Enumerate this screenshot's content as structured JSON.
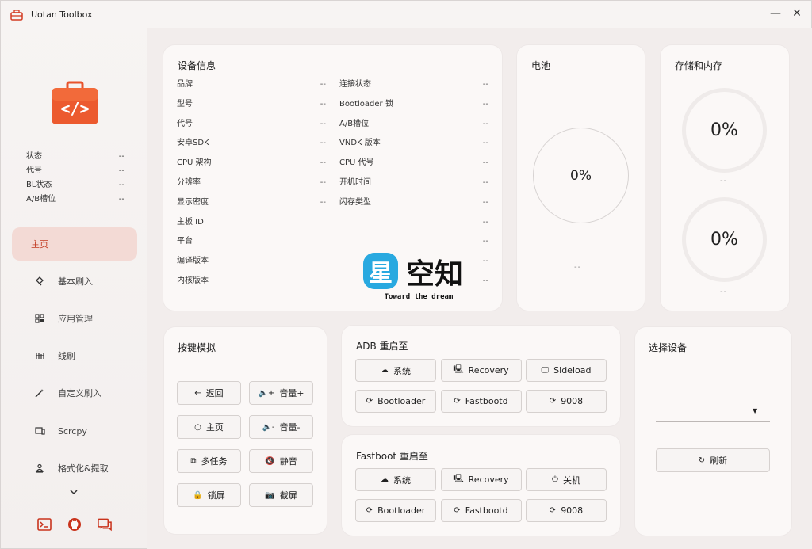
{
  "app": {
    "title": "Uotan Toolbox"
  },
  "window_controls": {
    "minimize": "—",
    "close": "✕"
  },
  "colors": {
    "accent": "#e8532c",
    "accent_bg": "#f3dad5",
    "active_text": "#c23b22"
  },
  "sidebar": {
    "status": [
      {
        "label": "状态",
        "value": "--"
      },
      {
        "label": "代号",
        "value": "--"
      },
      {
        "label": "BL状态",
        "value": "--"
      },
      {
        "label": "A/B槽位",
        "value": "--"
      }
    ],
    "nav": [
      {
        "label": "主页",
        "icon": "home-icon",
        "active": true
      },
      {
        "label": "基本刷入",
        "icon": "flash-icon"
      },
      {
        "label": "应用管理",
        "icon": "apps-grid-icon"
      },
      {
        "label": "线刷",
        "icon": "wire-flash-icon"
      },
      {
        "label": "自定义刷入",
        "icon": "magic-wand-icon"
      },
      {
        "label": "Scrcpy",
        "icon": "screen-mirror-icon"
      },
      {
        "label": "格式化&提取",
        "icon": "format-extract-icon"
      }
    ],
    "more": "⌄"
  },
  "device_info": {
    "title": "设备信息",
    "left": [
      {
        "label": "品牌",
        "value": "--"
      },
      {
        "label": "型号",
        "value": "--"
      },
      {
        "label": "代号",
        "value": "--"
      },
      {
        "label": "安卓SDK",
        "value": "--"
      },
      {
        "label": "CPU 架构",
        "value": "--"
      },
      {
        "label": "分辨率",
        "value": "--"
      },
      {
        "label": "显示密度",
        "value": "--"
      },
      {
        "label": "主板 ID",
        "value": "--"
      },
      {
        "label": "平台",
        "value": "--"
      },
      {
        "label": "编译版本",
        "value": "--"
      },
      {
        "label": "内核版本",
        "value": "--"
      }
    ],
    "right": [
      {
        "label": "连接状态",
        "value": "--"
      },
      {
        "label": "Bootloader 锁",
        "value": "--"
      },
      {
        "label": "A/B槽位",
        "value": "--"
      },
      {
        "label": "VNDK 版本",
        "value": "--"
      },
      {
        "label": "CPU 代号",
        "value": "--"
      },
      {
        "label": "开机时间",
        "value": "--"
      },
      {
        "label": "闪存类型",
        "value": "--"
      }
    ]
  },
  "battery": {
    "title": "电池",
    "percent": "0%",
    "detail": "--"
  },
  "storage": {
    "title": "存储和内存",
    "storage_percent": "0%",
    "storage_detail": "--",
    "memory_percent": "0%",
    "memory_detail": "--"
  },
  "keys": {
    "title": "按键模拟",
    "buttons": [
      {
        "label": "返回",
        "icon": "←"
      },
      {
        "label": "音量+",
        "icon": "🔈+"
      },
      {
        "label": "主页",
        "icon": "○"
      },
      {
        "label": "音量-",
        "icon": "🔈-"
      },
      {
        "label": "多任务",
        "icon": "⧉"
      },
      {
        "label": "静音",
        "icon": "🔇"
      },
      {
        "label": "锁屏",
        "icon": "🔒"
      },
      {
        "label": "截屏",
        "icon": "📷"
      }
    ]
  },
  "adb_reboot": {
    "title": "ADB 重启至",
    "buttons": [
      {
        "label": "系统",
        "icon": "☁"
      },
      {
        "label": "Recovery",
        "icon": "🖳"
      },
      {
        "label": "Sideload",
        "icon": "🖵"
      },
      {
        "label": "Bootloader",
        "icon": "⟳"
      },
      {
        "label": "Fastbootd",
        "icon": "⟳"
      },
      {
        "label": "9008",
        "icon": "⟳"
      }
    ]
  },
  "fastboot_reboot": {
    "title": "Fastboot 重启至",
    "buttons": [
      {
        "label": "系统",
        "icon": "☁"
      },
      {
        "label": "Recovery",
        "icon": "🖳"
      },
      {
        "label": "关机",
        "icon": "⏻"
      },
      {
        "label": "Bootloader",
        "icon": "⟳"
      },
      {
        "label": "Fastbootd",
        "icon": "⟳"
      },
      {
        "label": "9008",
        "icon": "⟳"
      }
    ]
  },
  "select_device": {
    "title": "选择设备",
    "selected": "",
    "refresh_label": "刷新",
    "refresh_icon": "↻"
  },
  "watermark": {
    "big": "空知",
    "char": "星",
    "tagline": "Toward the dream"
  }
}
